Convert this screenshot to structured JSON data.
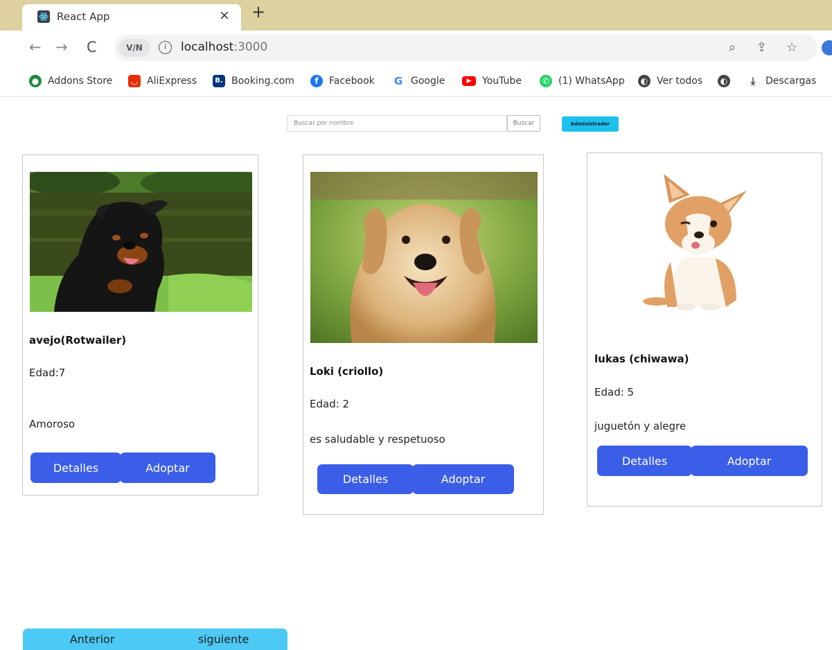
{
  "browser": {
    "tab_title": "React App",
    "tab_close": "×",
    "new_tab": "+",
    "nav_back": "←",
    "nav_forward": "→",
    "nav_reload": "C",
    "vpn_label": "V∕N",
    "info": "i",
    "url_host": "localhost",
    "url_port": ":3000",
    "zoom": "⌕",
    "share": "⇪",
    "star": "☆"
  },
  "bookmarks": [
    {
      "label": "Addons Store",
      "icon": "addons-icon",
      "color": "#1b8a3c",
      "glyph": "●"
    },
    {
      "label": "AliExpress",
      "icon": "aliexpress-icon",
      "color": "#e62e04",
      "glyph": "◡"
    },
    {
      "label": "Booking.com",
      "icon": "booking-icon",
      "color": "#003580",
      "glyph": "B."
    },
    {
      "label": "Facebook",
      "icon": "facebook-icon",
      "color": "#1877f2",
      "glyph": "f"
    },
    {
      "label": "Google",
      "icon": "google-icon",
      "color": "#ffffff",
      "glyph": "G"
    },
    {
      "label": "YouTube",
      "icon": "youtube-icon",
      "color": "#ff0000",
      "glyph": "▶"
    },
    {
      "label": "(1) WhatsApp",
      "icon": "whatsapp-icon",
      "color": "#25d366",
      "glyph": "✆"
    },
    {
      "label": "Ver todos",
      "icon": "globe-icon",
      "color": "#444444",
      "glyph": "◐"
    },
    {
      "label": "",
      "icon": "globe-icon",
      "color": "#444444",
      "glyph": "◐"
    },
    {
      "label": "Descargas",
      "icon": "download-icon",
      "color": "#ffffff",
      "glyph": "⤓"
    }
  ],
  "search": {
    "placeholder": "Buscar por nombre",
    "button": "Buscar"
  },
  "admin_button": "Administrador",
  "pets": [
    {
      "name": "avejo(Rotwailer)",
      "age": "Edad:7",
      "description": "Amoroso",
      "image": "rottweiler-photo",
      "details": "Detalles",
      "adopt": "Adoptar"
    },
    {
      "name": "Loki (criollo)",
      "age": "Edad: 2",
      "description": "es saludable y respetuoso",
      "image": "golden-retriever-photo",
      "details": "Detalles",
      "adopt": "Adoptar"
    },
    {
      "name": "lukas (chiwawa)",
      "age": "Edad: 5",
      "description": "juguetón y alegre",
      "image": "corgi-puppy-photo",
      "details": "Detalles",
      "adopt": "Adoptar"
    }
  ],
  "pagination": {
    "prev": "Anterior",
    "next": "siguiente"
  },
  "colors": {
    "tabbar": "#dcd19f",
    "primary_button": "#3b5ee8",
    "admin_button": "#1ec0ee",
    "pager_button": "#4cc9f5"
  }
}
